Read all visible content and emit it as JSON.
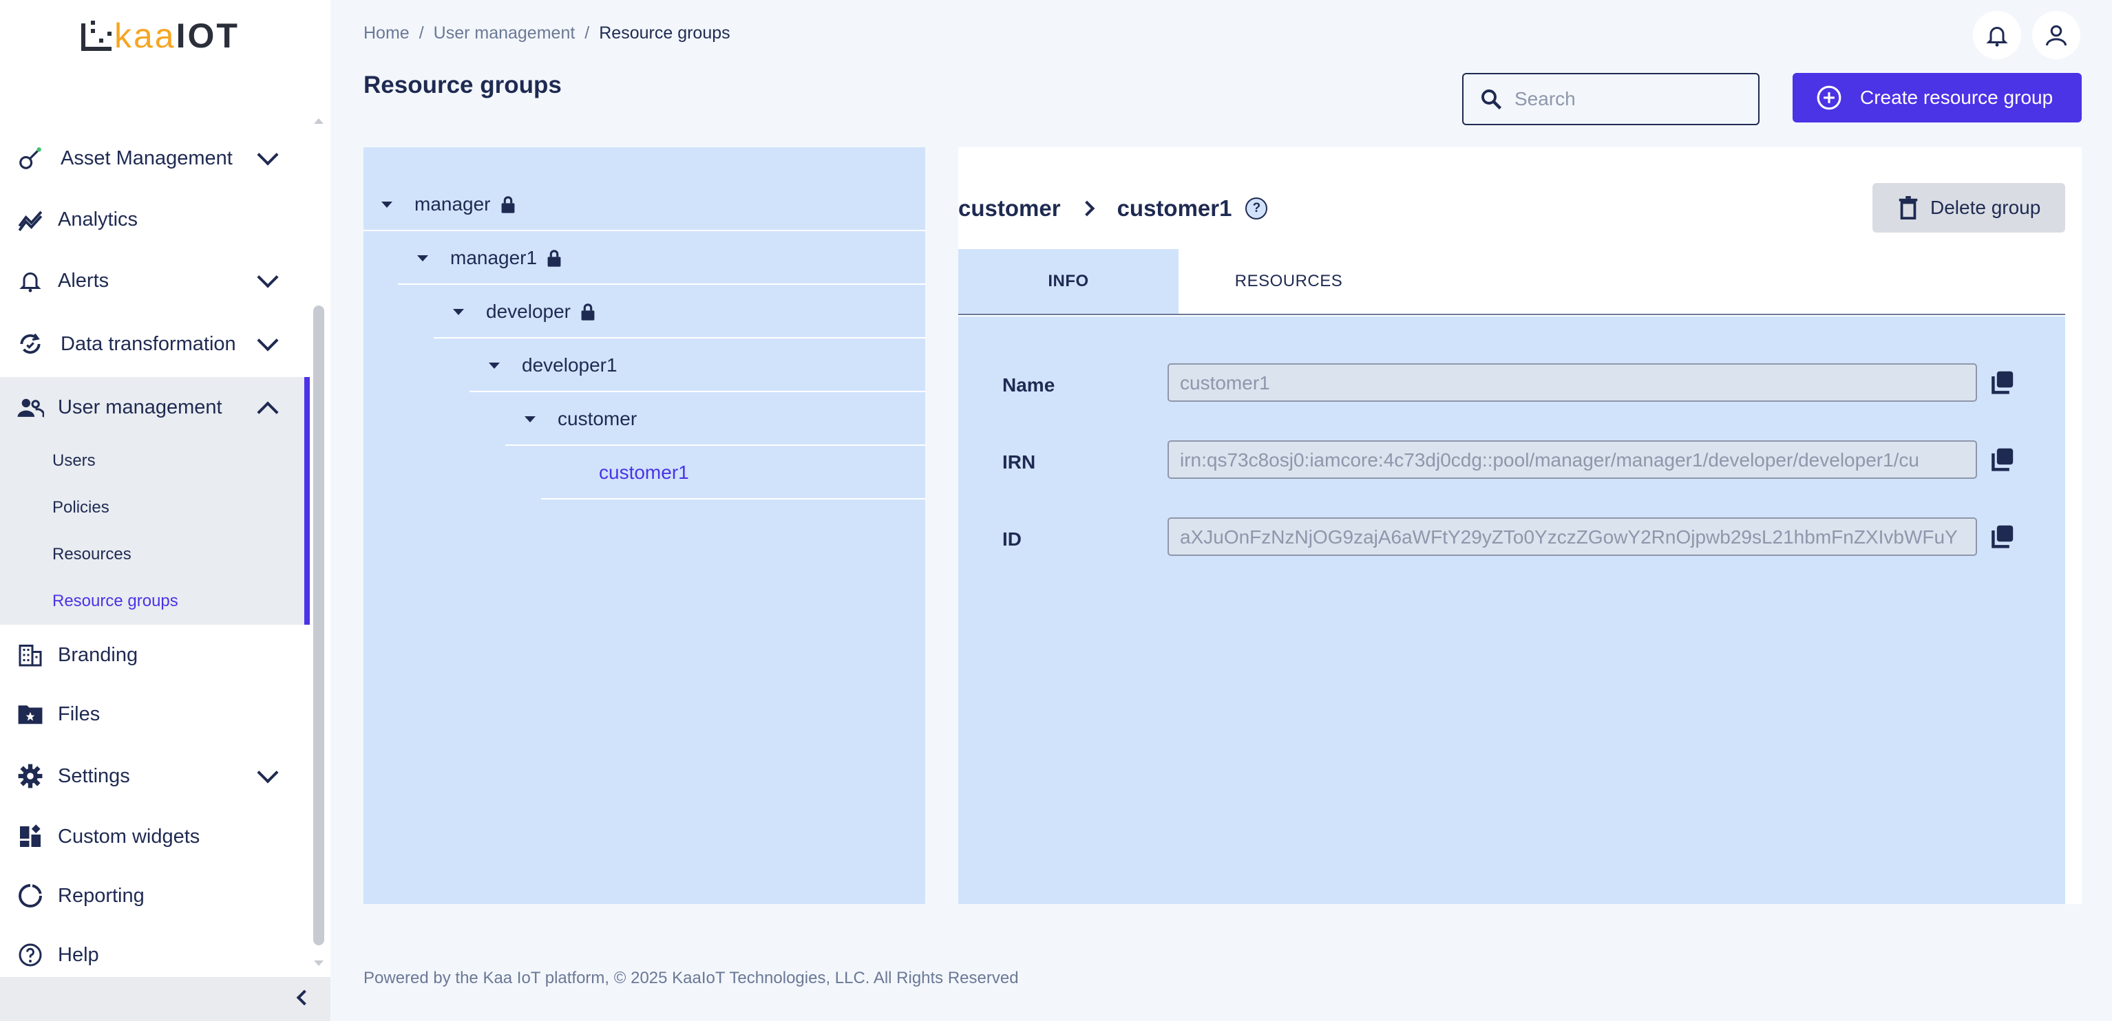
{
  "app": {
    "logo_kaa": "kaa",
    "logo_iot": "IOT"
  },
  "sidebar": {
    "items": [
      {
        "label": "Asset Management",
        "icon": "asset-icon"
      },
      {
        "label": "Analytics",
        "icon": "analytics-icon"
      },
      {
        "label": "Alerts",
        "icon": "bell-icon"
      },
      {
        "label": "Data transformation",
        "icon": "transform-icon"
      },
      {
        "label": "User management",
        "icon": "users-icon"
      },
      {
        "label": "Branding",
        "icon": "building-icon"
      },
      {
        "label": "Files",
        "icon": "folder-star-icon"
      },
      {
        "label": "Settings",
        "icon": "gear-icon"
      },
      {
        "label": "Custom widgets",
        "icon": "widgets-icon"
      },
      {
        "label": "Reporting",
        "icon": "reporting-icon"
      },
      {
        "label": "Help",
        "icon": "help-icon"
      }
    ],
    "user_management_sub": [
      "Users",
      "Policies",
      "Resources",
      "Resource groups"
    ]
  },
  "header": {
    "breadcrumb": [
      "Home",
      "User management",
      "Resource groups"
    ],
    "title": "Resource groups",
    "search_placeholder": "Search",
    "create_label": "Create resource group"
  },
  "tree": [
    {
      "name": "manager",
      "locked": true
    },
    {
      "name": "manager1",
      "locked": true
    },
    {
      "name": "developer",
      "locked": true
    },
    {
      "name": "developer1",
      "locked": false
    },
    {
      "name": "customer",
      "locked": false
    },
    {
      "name": "customer1",
      "locked": false,
      "selected": true
    }
  ],
  "detail": {
    "parent": "customer",
    "current": "customer1",
    "help": "?",
    "delete_label": "Delete group",
    "tabs": [
      "INFO",
      "RESOURCES"
    ],
    "fields": [
      {
        "label": "Name",
        "value": "customer1"
      },
      {
        "label": "IRN",
        "value": "irn:qs73c8osj0:iamcore:4c73dj0cdg::pool/manager/manager1/developer/developer1/cu"
      },
      {
        "label": "ID",
        "value": "aXJuOnFzNzNjOG9zajA6aWFtY29yZTo0YzczZGowY2RnOjpwb29sL21hbmFnZXIvbWFuY"
      }
    ]
  },
  "footer": "Powered by the Kaa IoT platform, © 2025 KaaIoT Technologies, LLC. All Rights Reserved",
  "colors": {
    "accent": "#4b33e6",
    "panel": "#d1e3fb",
    "text": "#1f2a52"
  }
}
